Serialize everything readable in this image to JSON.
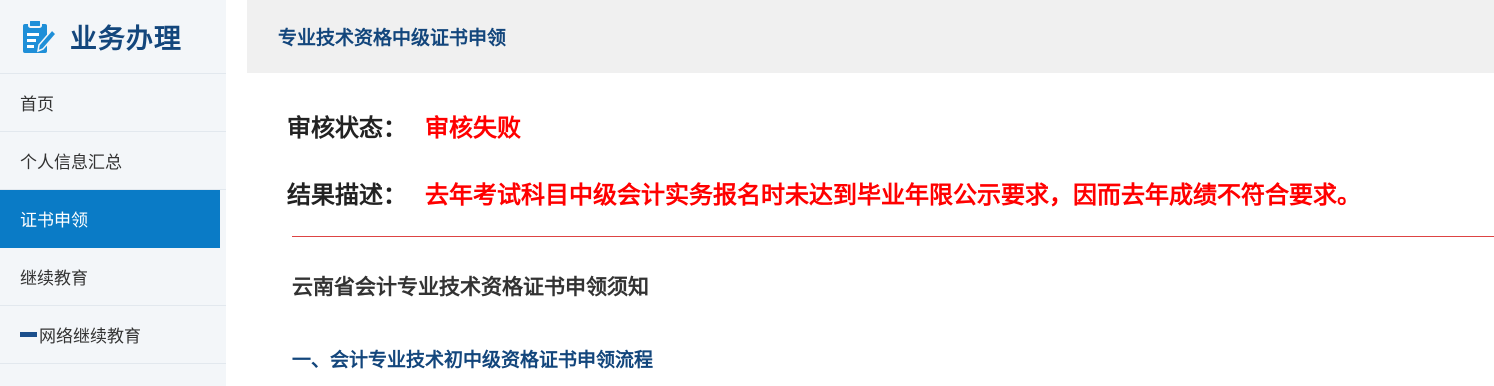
{
  "sidebar": {
    "title": "业务办理",
    "icon": "edit-document-icon",
    "items": [
      {
        "label": "首页"
      },
      {
        "label": "个人信息汇总"
      },
      {
        "label": "证书申领"
      },
      {
        "label": "继续教育"
      },
      {
        "label": "网络继续教育"
      }
    ],
    "active_index": 2
  },
  "header": {
    "title": "专业技术资格中级证书申领"
  },
  "review": {
    "status_label": "审核状态：",
    "status_value": "审核失败",
    "result_label": "结果描述：",
    "result_value": "去年考试科目中级会计实务报名时未达到毕业年限公示要求，因而去年成绩不符合要求。"
  },
  "notice": {
    "title": "云南省会计专业技术资格证书申领须知",
    "section1": "一、会计专业技术初中级资格证书申领流程"
  },
  "colors": {
    "brand": "#13467c",
    "active": "#0a7bc6",
    "error": "#ff0000"
  }
}
